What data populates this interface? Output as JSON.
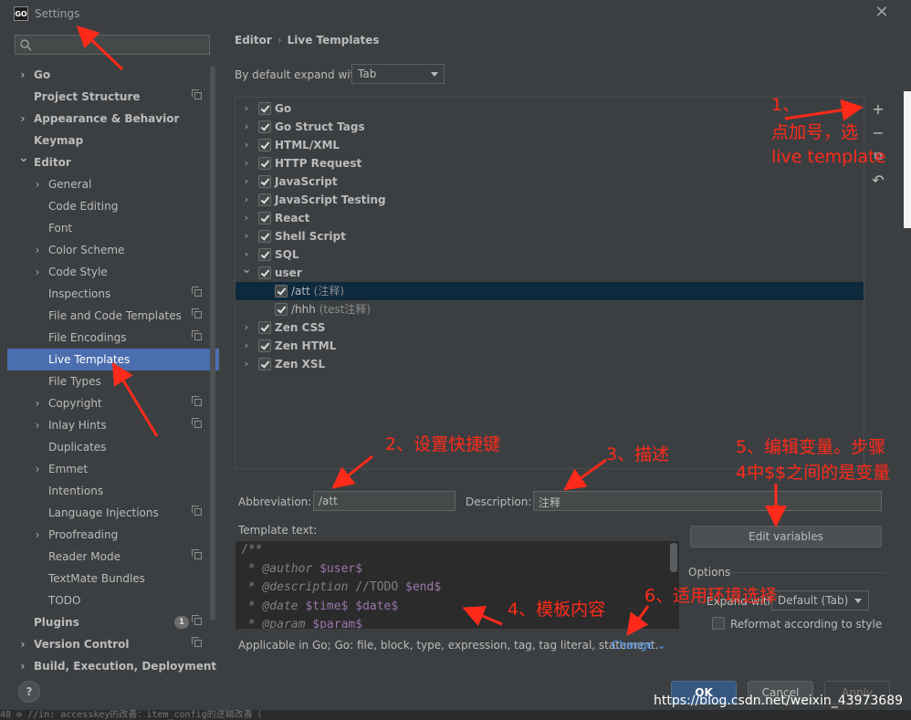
{
  "window": {
    "title": "Settings",
    "app_icon_text": "GO"
  },
  "sidebar": {
    "search_placeholder": "",
    "items": [
      {
        "label": "Go",
        "bold": true,
        "chevron": "right"
      },
      {
        "label": "Project Structure",
        "bold": true,
        "copy": true
      },
      {
        "label": "Appearance & Behavior",
        "bold": true,
        "chevron": "right"
      },
      {
        "label": "Keymap",
        "bold": true
      },
      {
        "label": "Editor",
        "bold": true,
        "chevron": "down"
      },
      {
        "label": "General",
        "chevron": "right"
      },
      {
        "label": "Code Editing"
      },
      {
        "label": "Font"
      },
      {
        "label": "Color Scheme",
        "chevron": "right"
      },
      {
        "label": "Code Style",
        "chevron": "right"
      },
      {
        "label": "Inspections",
        "copy": true
      },
      {
        "label": "File and Code Templates",
        "copy": true
      },
      {
        "label": "File Encodings",
        "copy": true
      },
      {
        "label": "Live Templates",
        "selected": true
      },
      {
        "label": "File Types"
      },
      {
        "label": "Copyright",
        "chevron": "right",
        "copy": true
      },
      {
        "label": "Inlay Hints",
        "chevron": "right",
        "copy": true
      },
      {
        "label": "Duplicates"
      },
      {
        "label": "Emmet",
        "chevron": "right"
      },
      {
        "label": "Intentions"
      },
      {
        "label": "Language Injections",
        "copy": true
      },
      {
        "label": "Proofreading",
        "chevron": "right"
      },
      {
        "label": "Reader Mode",
        "copy": true
      },
      {
        "label": "TextMate Bundles"
      },
      {
        "label": "TODO"
      },
      {
        "label": "Plugins",
        "bold": true,
        "badge": "1",
        "copy": true
      },
      {
        "label": "Version Control",
        "bold": true,
        "chevron": "right",
        "copy": true
      },
      {
        "label": "Build, Execution, Deployment",
        "bold": true,
        "chevron": "right"
      }
    ]
  },
  "breadcrumb": {
    "parent": "Editor",
    "sep": "›",
    "current": "Live Templates"
  },
  "expand": {
    "label": "By default expand with",
    "value": "Tab"
  },
  "templates": [
    {
      "label": "Go",
      "checked": true,
      "expanded": false
    },
    {
      "label": "Go Struct Tags",
      "checked": true,
      "expanded": false
    },
    {
      "label": "HTML/XML",
      "checked": true,
      "expanded": false
    },
    {
      "label": "HTTP Request",
      "checked": true,
      "expanded": false
    },
    {
      "label": "JavaScript",
      "checked": true,
      "expanded": false
    },
    {
      "label": "JavaScript Testing",
      "checked": true,
      "expanded": false
    },
    {
      "label": "React",
      "checked": true,
      "expanded": false
    },
    {
      "label": "Shell Script",
      "checked": true,
      "expanded": false
    },
    {
      "label": "SQL",
      "checked": true,
      "expanded": false
    },
    {
      "label": "user",
      "checked": true,
      "expanded": true,
      "children": [
        {
          "abbr": "/att",
          "desc": "(注释)",
          "checked": true,
          "selected": true
        },
        {
          "abbr": "/hhh",
          "desc": "(test注释)",
          "checked": true
        }
      ]
    },
    {
      "label": "Zen CSS",
      "checked": true,
      "expanded": false
    },
    {
      "label": "Zen HTML",
      "checked": true,
      "expanded": false
    },
    {
      "label": "Zen XSL",
      "checked": true,
      "expanded": false
    }
  ],
  "toolbar": {
    "add": "+",
    "remove": "−",
    "copy": "⧉",
    "restore": "↶"
  },
  "abbreviation": {
    "label": "Abbreviation:",
    "value": "/att"
  },
  "description": {
    "label": "Description:",
    "value": "注释"
  },
  "template_text": {
    "label": "Template text:",
    "lines": [
      [
        {
          "t": "/**",
          "c": "c-com"
        }
      ],
      [
        {
          "t": " * ",
          "c": "c-com"
        },
        {
          "t": "@author",
          "c": "c-tag"
        },
        {
          "t": " ",
          "c": "c-com"
        },
        {
          "t": "$user$",
          "c": "c-var"
        }
      ],
      [
        {
          "t": " * ",
          "c": "c-com"
        },
        {
          "t": "@description",
          "c": "c-tag"
        },
        {
          "t": " ",
          "c": "c-com"
        },
        {
          "t": "//TODO",
          "c": "c-com"
        },
        {
          "t": " ",
          "c": "c-com"
        },
        {
          "t": "$end$",
          "c": "c-var"
        }
      ],
      [
        {
          "t": " * ",
          "c": "c-com"
        },
        {
          "t": "@date",
          "c": "c-tag"
        },
        {
          "t": " ",
          "c": "c-com"
        },
        {
          "t": "$time$",
          "c": "c-var"
        },
        {
          "t": " ",
          "c": "c-com"
        },
        {
          "t": "$date$",
          "c": "c-var"
        }
      ],
      [
        {
          "t": " * ",
          "c": "c-com"
        },
        {
          "t": "@param",
          "c": "c-tag"
        },
        {
          "t": " ",
          "c": "c-com"
        },
        {
          "t": "$param$",
          "c": "c-var"
        }
      ]
    ]
  },
  "edit_variables": "Edit variables",
  "options": {
    "label": "Options",
    "expand_with_label": "Expand with",
    "expand_with_value": "Default (Tab)",
    "reformat_label": "Reformat according to style",
    "reformat_checked": false
  },
  "applicable": {
    "text": "Applicable in Go; Go: file, block, type, expression, tag, tag literal, statement.",
    "change": "Change"
  },
  "buttons": {
    "help": "?",
    "ok": "OK",
    "cancel": "Cancel",
    "apply": "Apply"
  },
  "background_code": "  48     ⊖     //in: accesskey的改善：item_config的逻辑改善（",
  "watermark": "https://blog.csdn.net/weixin_43973689",
  "annotations": {
    "a1": "1、",
    "a1b": "点加号，选",
    "a1c": "live template",
    "a2": "2、设置快捷键",
    "a3": "3、描述",
    "a5": "5、编辑变量。步骤",
    "a5b": "4中$$之间的是变量",
    "a4": "4、模板内容",
    "a6": "6、适用环境选择",
    "color": "#ff2a1a"
  }
}
